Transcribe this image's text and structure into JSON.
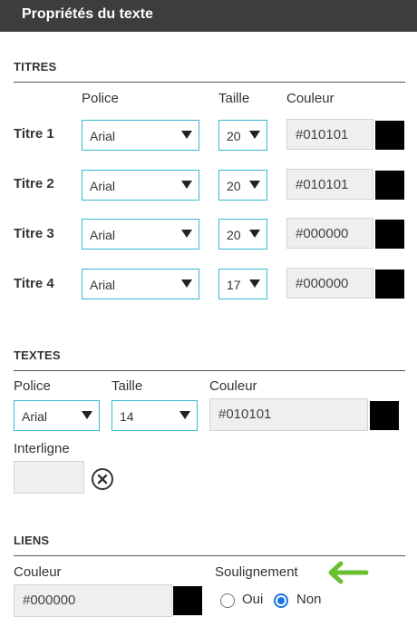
{
  "header": {
    "title": "Propriétés du texte"
  },
  "titres": {
    "section_title": "TITRES",
    "col_police": "Police",
    "col_taille": "Taille",
    "col_couleur": "Couleur",
    "rows": [
      {
        "label": "Titre 1",
        "police": "Arial",
        "taille": "20",
        "couleur": "#010101",
        "swatch": "#010101"
      },
      {
        "label": "Titre 2",
        "police": "Arial",
        "taille": "20",
        "couleur": "#010101",
        "swatch": "#010101"
      },
      {
        "label": "Titre 3",
        "police": "Arial",
        "taille": "20",
        "couleur": "#000000",
        "swatch": "#000000"
      },
      {
        "label": "Titre 4",
        "police": "Arial",
        "taille": "17",
        "couleur": "#000000",
        "swatch": "#000000"
      }
    ]
  },
  "textes": {
    "section_title": "TEXTES",
    "police_label": "Police",
    "police_value": "Arial",
    "taille_label": "Taille",
    "taille_value": "14",
    "couleur_label": "Couleur",
    "couleur_value": "#010101",
    "swatch": "#010101",
    "interligne_label": "Interligne",
    "interligne_value": ""
  },
  "liens": {
    "section_title": "LIENS",
    "couleur_label": "Couleur",
    "couleur_value": "#000000",
    "swatch": "#000000",
    "soulignement_label": "Soulignement",
    "option_oui": "Oui",
    "option_non": "Non",
    "selected": "Non"
  },
  "colors": {
    "header_bg": "#3d3d3d",
    "select_border": "#37b8d5",
    "radio_accent": "#1a73e8",
    "arrow_accent": "#6abf2e"
  },
  "icons": {
    "clear": "clear-circle-x-icon",
    "arrow": "left-arrow-icon"
  }
}
